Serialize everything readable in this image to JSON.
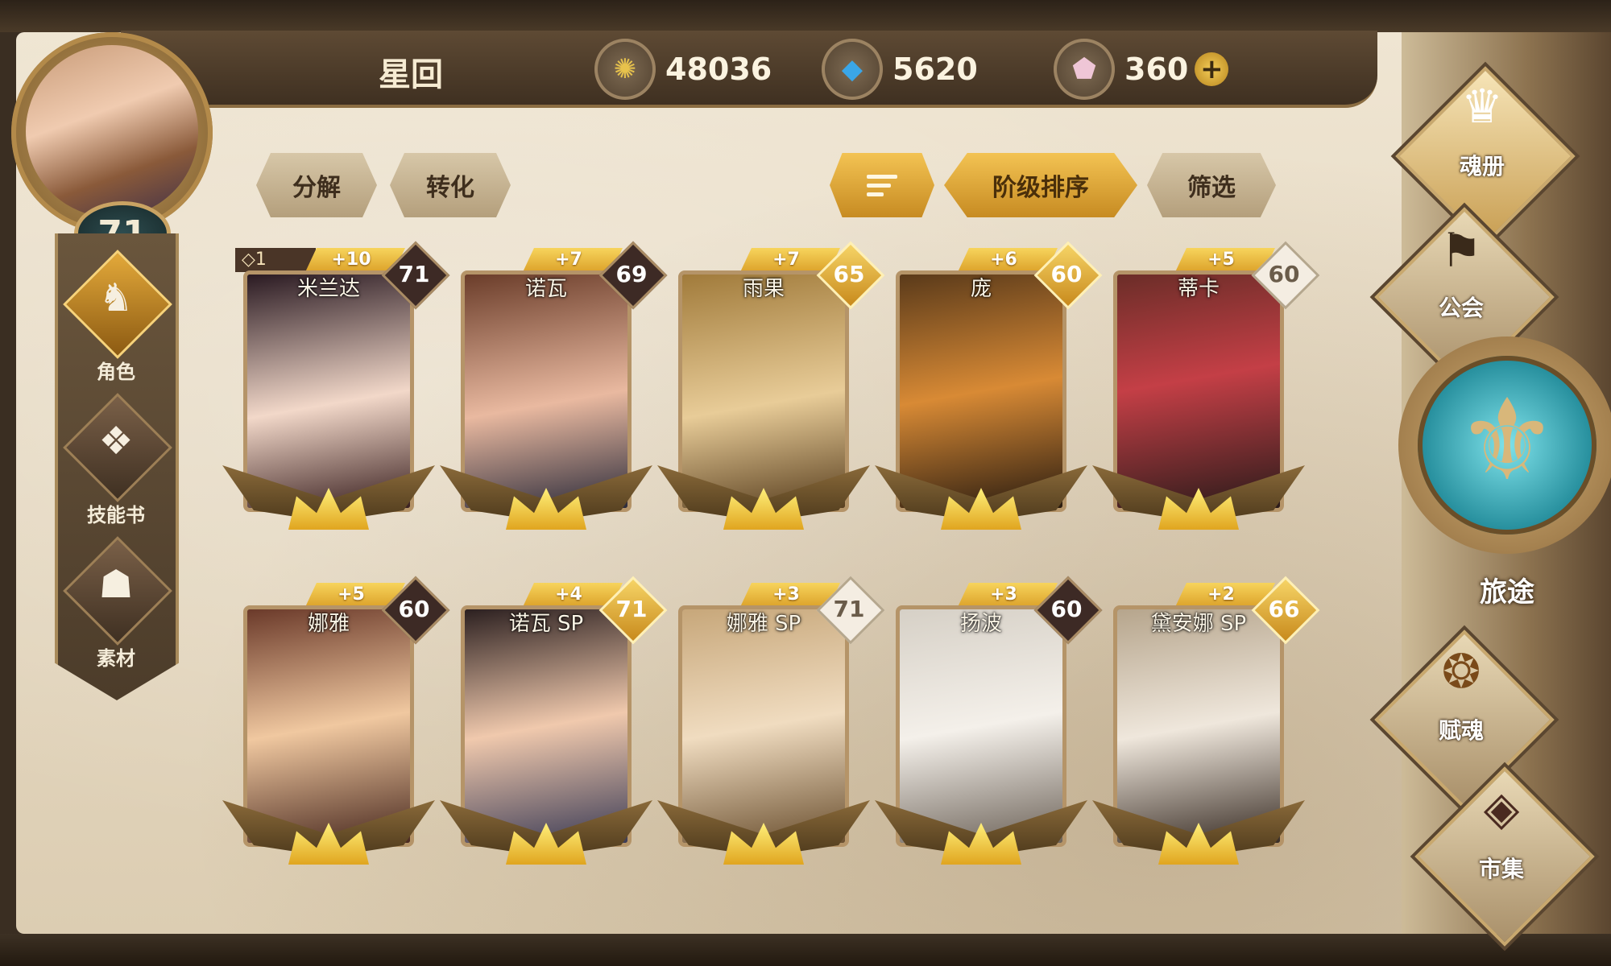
{
  "header": {
    "player_name": "星回",
    "player_level": "71",
    "resources": [
      {
        "icon": "gold-coin-icon",
        "value": "48036"
      },
      {
        "icon": "blue-gem-icon",
        "value": "5620"
      },
      {
        "icon": "pink-crystal-icon",
        "value": "360"
      }
    ],
    "add_label": "+"
  },
  "left_nav": [
    {
      "label": "角色",
      "icon": "character-icon",
      "active": true
    },
    {
      "label": "技能书",
      "icon": "skill-book-icon",
      "active": false
    },
    {
      "label": "素材",
      "icon": "material-icon",
      "active": false
    }
  ],
  "actions": {
    "decompose": "分解",
    "convert": "转化",
    "sort": "阶级排序",
    "filter": "筛选"
  },
  "cards": [
    {
      "name": "米兰达",
      "stars": "+10",
      "level": "71",
      "favorite": "◇1",
      "style": "max-dark"
    },
    {
      "name": "诺瓦",
      "stars": "+7",
      "level": "69",
      "style": "dark"
    },
    {
      "name": "雨果",
      "stars": "+7",
      "level": "65",
      "style": "gold"
    },
    {
      "name": "庞",
      "stars": "+6",
      "level": "60",
      "style": "gold"
    },
    {
      "name": "蒂卡",
      "stars": "+5",
      "level": "60",
      "style": "light"
    },
    {
      "name": "娜雅",
      "stars": "+5",
      "level": "60",
      "style": "dark"
    },
    {
      "name": "诺瓦 SP",
      "stars": "+4",
      "level": "71",
      "style": "gold"
    },
    {
      "name": "娜雅 SP",
      "stars": "+3",
      "level": "71",
      "style": "light"
    },
    {
      "name": "扬波",
      "stars": "+3",
      "level": "60",
      "style": "dark"
    },
    {
      "name": "黛安娜 SP",
      "stars": "+2",
      "level": "66",
      "style": "gold"
    }
  ],
  "right_nav": [
    {
      "label": "魂册",
      "icon": "soul-book-icon"
    },
    {
      "label": "公会",
      "icon": "guild-icon"
    },
    {
      "label": "旅途",
      "icon": "journey-icon"
    },
    {
      "label": "赋魂",
      "icon": "soul-infuse-icon"
    },
    {
      "label": "市集",
      "icon": "market-icon"
    }
  ],
  "colors": {
    "accent_gold": "#f3c353",
    "parchment": "#e8dcc5",
    "frame_brown": "#4a3a28"
  }
}
